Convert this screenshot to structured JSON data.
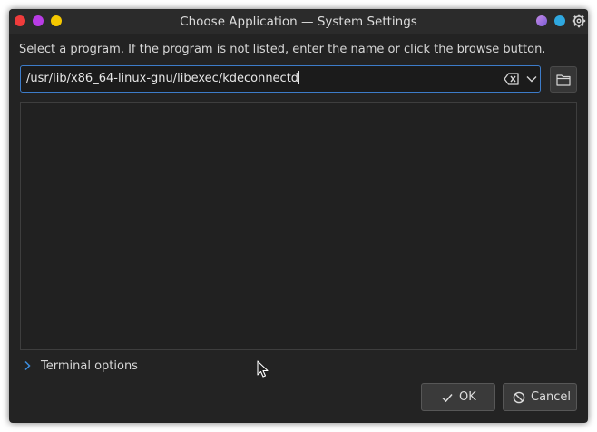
{
  "window": {
    "title": "Choose Application — System Settings",
    "controls": {
      "close_color": "#f03c3c",
      "minimize_color": "#b93ce6",
      "maximize_color": "#f5c800"
    },
    "right_icons": [
      "purple-gradient-dot-icon",
      "blue-dot-icon",
      "gear-icon"
    ]
  },
  "dialog": {
    "instruction": "Select a program. If the program is not listed, enter the name or click the browse button.",
    "path_input": {
      "value": "/usr/lib/x86_64-linux-gnu/libexec/kdeconnectd"
    },
    "terminal_options_label": "Terminal options",
    "ok_label": "OK",
    "cancel_label": "Cancel"
  },
  "colors": {
    "accent": "#3d7cc9",
    "background": "#232323"
  }
}
